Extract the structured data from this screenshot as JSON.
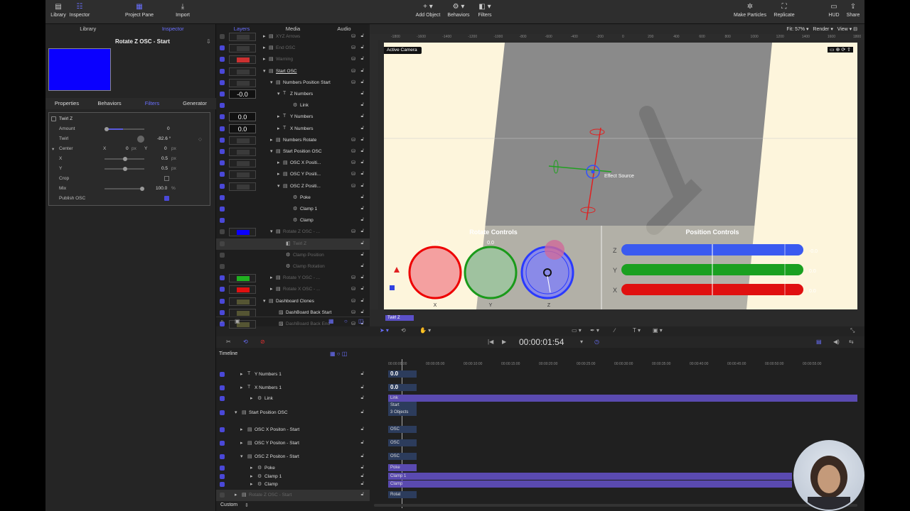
{
  "toolbar": {
    "library": "Library",
    "inspector": "Inspector",
    "project_pane": "Project Pane",
    "import": "Import",
    "add_object": "Add Object",
    "behaviors": "Behaviors",
    "filters": "Filters",
    "make_particles": "Make Particles",
    "replicate": "Replicate",
    "hud": "HUD",
    "share": "Share"
  },
  "left_tabs": [
    "Library",
    "Inspector"
  ],
  "inspector": {
    "title": "Rotate Z OSC - Start",
    "swatch_color": "#0a00ff",
    "tabs": [
      "Properties",
      "Behaviors",
      "Filters",
      "Generator"
    ],
    "filter_name": "Twirl Z",
    "params": {
      "amount_label": "Amount",
      "amount_value": "0",
      "twirl_label": "Twirl",
      "twirl_value": "-82.6 °",
      "center_label": "Center",
      "center_x_label": "X",
      "center_x": "0",
      "center_y_label": "Y",
      "center_y": "0",
      "px": "px",
      "x_label": "X",
      "x_value": "0.5",
      "y_label": "Y",
      "y_value": "0.5",
      "crop_label": "Crop",
      "mix_label": "Mix",
      "mix_value": "100.0",
      "pct": "%",
      "publish_label": "Publish OSC"
    }
  },
  "layer_tabs": [
    "Layers",
    "Media",
    "Audio"
  ],
  "layers": [
    {
      "name": "XYZ Arrows",
      "dim": true
    },
    {
      "name": "End OSC",
      "dim": true
    },
    {
      "name": "Warning",
      "dim": true
    },
    {
      "name": "Start OSC",
      "dim": false
    },
    {
      "name": "Numbers Position Start",
      "dim": false
    },
    {
      "name": "Z Numbers",
      "dim": false,
      "value": "-0.0"
    },
    {
      "name": "Link",
      "dim": false
    },
    {
      "name": "Y Numbers",
      "dim": false,
      "value": "0.0"
    },
    {
      "name": "X Numbers",
      "dim": false,
      "value": "0.0"
    },
    {
      "name": "Numbers Rotate",
      "dim": false
    },
    {
      "name": "Start Position OSC",
      "dim": false
    },
    {
      "name": "OSC X Positi...",
      "dim": false
    },
    {
      "name": "OSC Y Positi...",
      "dim": false
    },
    {
      "name": "OSC Z Positi...",
      "dim": false
    },
    {
      "name": "Poke",
      "dim": false
    },
    {
      "name": "Clamp 1",
      "dim": false
    },
    {
      "name": "Clamp",
      "dim": false
    },
    {
      "name": "Rotate Z OSC - ...",
      "dim": true
    },
    {
      "name": "Twirl Z",
      "dim": true
    },
    {
      "name": "Clamp Position",
      "dim": true
    },
    {
      "name": "Clamp Rotation",
      "dim": true
    },
    {
      "name": "Rotate Y OSC - ...",
      "dim": true
    },
    {
      "name": "Rotate X OSC - ...",
      "dim": true
    },
    {
      "name": "Dashboard Clones",
      "dim": false
    },
    {
      "name": "DashBoard Back Start",
      "dim": false
    },
    {
      "name": "DashBoard Back End",
      "dim": true
    }
  ],
  "canvas": {
    "fit": "Fit: 57%",
    "render": "Render",
    "view": "View",
    "camera": "Active Camera",
    "effect_source": "Effect Source",
    "rotate_controls": "Rotate Controls",
    "position_controls": "Position Controls",
    "ring_values": [
      "0.0",
      "0.0"
    ],
    "ring_labels": [
      "X",
      "Y",
      "Z"
    ],
    "bar_labels": [
      "Z",
      "Y",
      "X"
    ],
    "bar_values": [
      "-0.0",
      "0.0",
      "0.0"
    ],
    "ruler": [
      "-1800",
      "-1600",
      "-1400",
      "-1200",
      "-1000",
      "-800",
      "-600",
      "-400",
      "-200",
      "0",
      "200",
      "400",
      "600",
      "800",
      "1000",
      "1200",
      "1400",
      "1600",
      "1800"
    ],
    "twirl_tag": "Twirl Z"
  },
  "transport": {
    "timecode": "00:00:01:54"
  },
  "timeline": {
    "title": "Timeline",
    "rows": [
      {
        "name": "Y Numbers 1",
        "bar": "0.0"
      },
      {
        "name": "X Numbers 1",
        "bar": "0.0"
      },
      {
        "name": "Link",
        "bar": "Link"
      },
      {
        "name": "Start Position OSC",
        "bar": "3 Objects"
      },
      {
        "name": "OSC X Positon - Start",
        "bar": "OSC"
      },
      {
        "name": "OSC Y Positon - Start",
        "bar": "OSC"
      },
      {
        "name": "OSC Z Positon - Start",
        "bar": "OSC"
      },
      {
        "name": "Poke",
        "bar": "Poke"
      },
      {
        "name": "Clamp 1",
        "bar": "Clamp 1"
      },
      {
        "name": "Clamp",
        "bar": "Clamp"
      },
      {
        "name": "Rotate Z OSC - Start",
        "bar": "Rotat"
      }
    ],
    "start_label": "Start",
    "ticks": [
      "00:00:00:00",
      "00:00:05:00",
      "00:00:10:00",
      "00:00:15:00",
      "00:00:20:00",
      "00:00:25:00",
      "00:00:30:00",
      "00:00:35:00",
      "00:00:40:00",
      "00:00:45:00",
      "00:00:50:00",
      "00:00:55:00"
    ],
    "custom": "Custom"
  }
}
